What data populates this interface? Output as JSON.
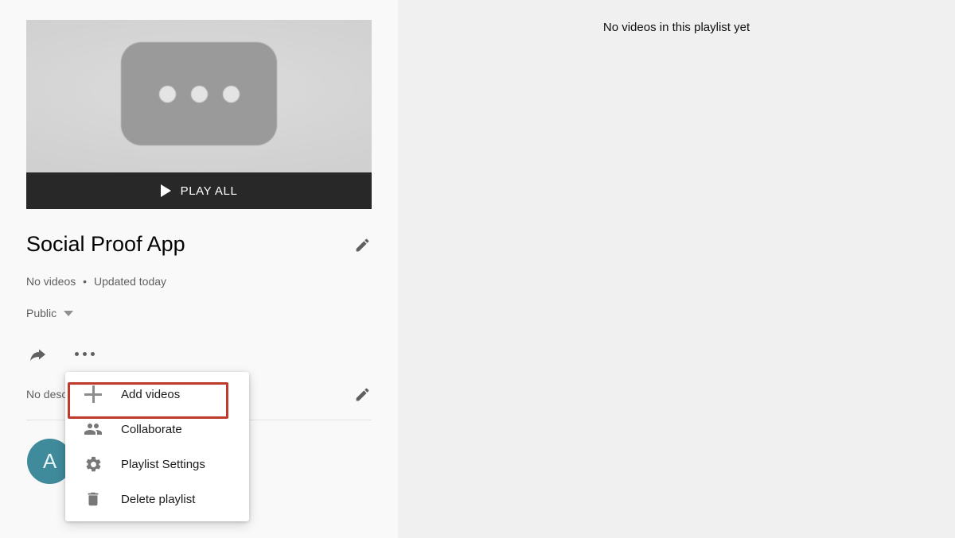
{
  "colors": {
    "left_panel_bg": "#f9f9f9",
    "right_panel_bg": "#f0f0f0",
    "play_bar_bg": "#282828",
    "avatar_bg": "#3f8a9b",
    "highlight_border": "#c0392b",
    "menu_bg": "#ffffff"
  },
  "playlist": {
    "thumbnail": {
      "placeholder_icon": "video-placeholder-icon",
      "play_all_label": "PLAY ALL",
      "play_icon": "play-triangle-icon"
    },
    "title": "Social Proof App",
    "title_edit_icon": "pencil-icon",
    "video_count": "No videos",
    "separator": "•",
    "updated": "Updated today",
    "visibility": "Public",
    "visibility_caret": "chevron-down-icon",
    "share_icon": "share-arrow-icon",
    "more_icon": "more-horizontal-icon",
    "description": "No description",
    "description_edit_icon": "pencil-icon",
    "avatar_initial": "A"
  },
  "menu": {
    "items": [
      {
        "label": "Add videos",
        "icon": "plus-icon",
        "highlighted": true
      },
      {
        "label": "Collaborate",
        "icon": "people-icon",
        "highlighted": false
      },
      {
        "label": "Playlist Settings",
        "icon": "gear-icon",
        "highlighted": false
      },
      {
        "label": "Delete playlist",
        "icon": "trash-icon",
        "highlighted": false
      }
    ]
  },
  "content": {
    "empty_message": "No videos in this playlist yet"
  }
}
